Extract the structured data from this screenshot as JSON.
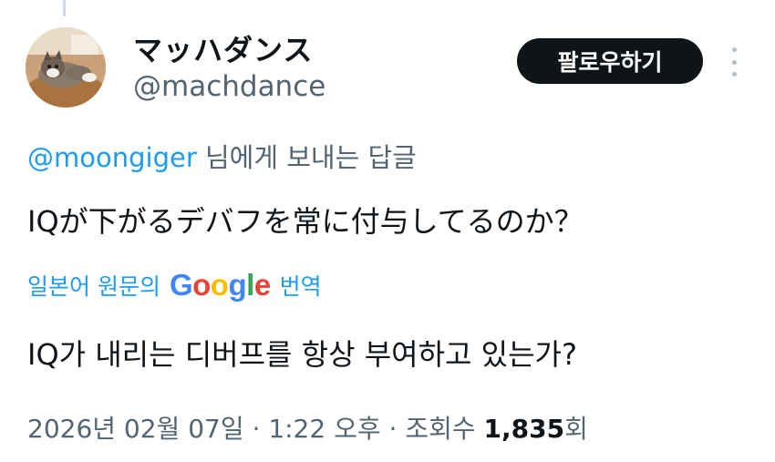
{
  "author": {
    "display_name": "マッハダンス",
    "handle": "@machdance",
    "avatar": "cat-avatar"
  },
  "actions": {
    "follow_label": "팔로우하기",
    "more_icon": "more-vertical-icon"
  },
  "reply_context": {
    "mention": "@moongiger",
    "suffix": " 님에게 보내는 답글"
  },
  "tweet": {
    "text": "IQが下がるデバフを常に付与してるのか？"
  },
  "translation": {
    "prefix": "일본어 원문의",
    "provider_letters": [
      "G",
      "o",
      "o",
      "g",
      "l",
      "e"
    ],
    "suffix": "번역",
    "text": "IQ가 내리는 디버프를 항상 부여하고 있는가?"
  },
  "meta": {
    "date": "2026년 02월 07일",
    "separator": " · ",
    "time": "1:22 오후",
    "views_label": "조회수",
    "views_count": "1,835",
    "views_suffix": "회"
  },
  "colors": {
    "link": "#1d9bf0",
    "secondary_text": "#536471",
    "primary_text": "#0f1419",
    "button_bg": "#0f1419"
  }
}
